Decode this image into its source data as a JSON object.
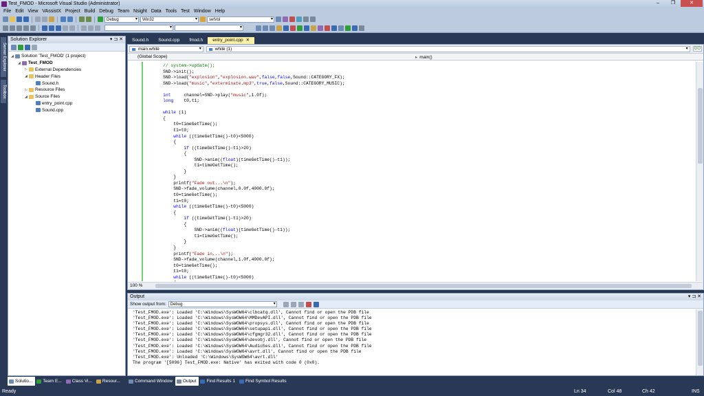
{
  "window": {
    "title": "Test_FMOD - Microsoft Visual Studio (Administrator)",
    "buttons": [
      "–",
      "❐",
      "✕"
    ]
  },
  "menu": [
    "File",
    "Edit",
    "View",
    "VAssistX",
    "Project",
    "Build",
    "Debug",
    "Team",
    "Nsight",
    "Data",
    "Tools",
    "Test",
    "Window",
    "Help"
  ],
  "toolbar": {
    "config": "Debug",
    "platform": "Win32",
    "find": "setVol"
  },
  "side_tabs": [
    "Server Explorer",
    "Toolbox"
  ],
  "solution_explorer": {
    "title": "Solution Explorer",
    "header_buttons": "▾ ⊐ ✕",
    "tree": [
      {
        "label": "Solution 'Test_FMOD' (1 project)",
        "level": 0,
        "icon": "solution-icon"
      },
      {
        "label": "Test_FMOD",
        "level": 1,
        "icon": "project-icon",
        "bold": true
      },
      {
        "label": "External Dependencies",
        "level": 2,
        "icon": "folder-icon"
      },
      {
        "label": "Header Files",
        "level": 2,
        "icon": "folder-icon"
      },
      {
        "label": "Sound.h",
        "level": 3,
        "icon": "header-file-icon"
      },
      {
        "label": "Resource Files",
        "level": 2,
        "icon": "folder-icon"
      },
      {
        "label": "Source Files",
        "level": 2,
        "icon": "folder-icon"
      },
      {
        "label": "entry_point.cpp",
        "level": 3,
        "icon": "cpp-file-icon"
      },
      {
        "label": "Sound.cpp",
        "level": 3,
        "icon": "cpp-file-icon"
      }
    ]
  },
  "left_bottom_tabs": [
    "Solutio...",
    "Team E...",
    "Class Vi...",
    "Resour..."
  ],
  "doc_tabs": [
    {
      "label": "Sound.h",
      "active": false
    },
    {
      "label": "Sound.cpp",
      "active": false
    },
    {
      "label": "fmod.h",
      "active": false
    },
    {
      "label": "entry_point.cpp",
      "active": true
    }
  ],
  "doc_tab_close": "✕",
  "editor": {
    "nav_left": "main.while",
    "nav_right": "while (1)",
    "go_button": "GO",
    "scope": "(Global Scope)",
    "function": "main()",
    "zoom": "100 %",
    "code_lines": [
      "    // system->update();",
      "    SND->init();",
      "    SND->load(\"explosion\",\"explosion.wav\",false,false,Sound::CATEGORY_FX);",
      "    SND->load(\"music\",\"exterminate.mp3\",true,false,Sound::CATEGORY_MUSIC);",
      "",
      "    int     channel=SND->play(\"music\",1.0f);",
      "    long    t0,t1;",
      "",
      "    while (1)",
      "    {",
      "        t0=timeGetTime();",
      "        t1=t0;",
      "        while ((timeGetTime()-t0)<5000)",
      "        {",
      "            if ((timeGetTime()-t1)>20)",
      "            {",
      "                SND->anim((float)(timeGetTime()-t1));",
      "                t1=timeGetTime();",
      "            }",
      "        }",
      "        printf(\"Fade out...\\n\");",
      "        SND->fade_volume(channel,0.0f,4000.0f);",
      "        t0=timeGetTime();",
      "        t1=t0;",
      "        while ((timeGetTime()-t0)<5000)",
      "        {",
      "            if ((timeGetTime()-t1)>20)",
      "            {",
      "                SND->anim((float)(timeGetTime()-t1));",
      "                t1=timeGetTime();",
      "            }",
      "        }",
      "        printf(\"Fade in...\\n\");",
      "        SND->fade_volume(channel,1.0f,4000.0f);",
      "        t0=timeGetTime();",
      "        t1=t0;",
      "        while ((timeGetTime()-t0)<5000)",
      "        {"
    ]
  },
  "output": {
    "title": "Output",
    "header_buttons": "▾ ⊐ ✕",
    "show_from_label": "Show output from:",
    "source": "Debug",
    "lines": [
      "'Test_FMOD.exe': Loaded 'C:\\Windows\\SysWOW64\\clbcatq.dll', Cannot find or open the PDB file",
      "'Test_FMOD.exe': Loaded 'C:\\Windows\\SysWOW64\\MMDevAPI.dll', Cannot find or open the PDB file",
      "'Test_FMOD.exe': Loaded 'C:\\Windows\\SysWOW64\\propsys.dll', Cannot find or open the PDB file",
      "'Test_FMOD.exe': Loaded 'C:\\Windows\\SysWOW64\\setupapi.dll', Cannot find or open the PDB file",
      "'Test_FMOD.exe': Loaded 'C:\\Windows\\SysWOW64\\cfgmgr32.dll', Cannot find or open the PDB file",
      "'Test_FMOD.exe': Loaded 'C:\\Windows\\SysWOW64\\devobj.dll', Cannot find or open the PDB file",
      "'Test_FMOD.exe': Loaded 'C:\\Windows\\SysWOW64\\AudioSes.dll', Cannot find or open the PDB file",
      "'Test_FMOD.exe': Loaded 'C:\\Windows\\SysWOW64\\avrt.dll', Cannot find or open the PDB file",
      "'Test_FMOD.exe': Unloaded 'C:\\Windows\\SysWOW64\\avrt.dll'",
      "The program '[5096] Test_FMOD.exe: Native' has exited with code 0 (0x0)."
    ]
  },
  "bottom_tabs": [
    {
      "label": "Command Window",
      "active": false
    },
    {
      "label": "Output",
      "active": true
    },
    {
      "label": "Find Results 1",
      "active": false
    },
    {
      "label": "Find Symbol Results",
      "active": false
    }
  ],
  "status": {
    "text": "Ready",
    "ln": "Ln 34",
    "col": "Col 48",
    "ch": "Ch 42",
    "mode": "INS"
  }
}
